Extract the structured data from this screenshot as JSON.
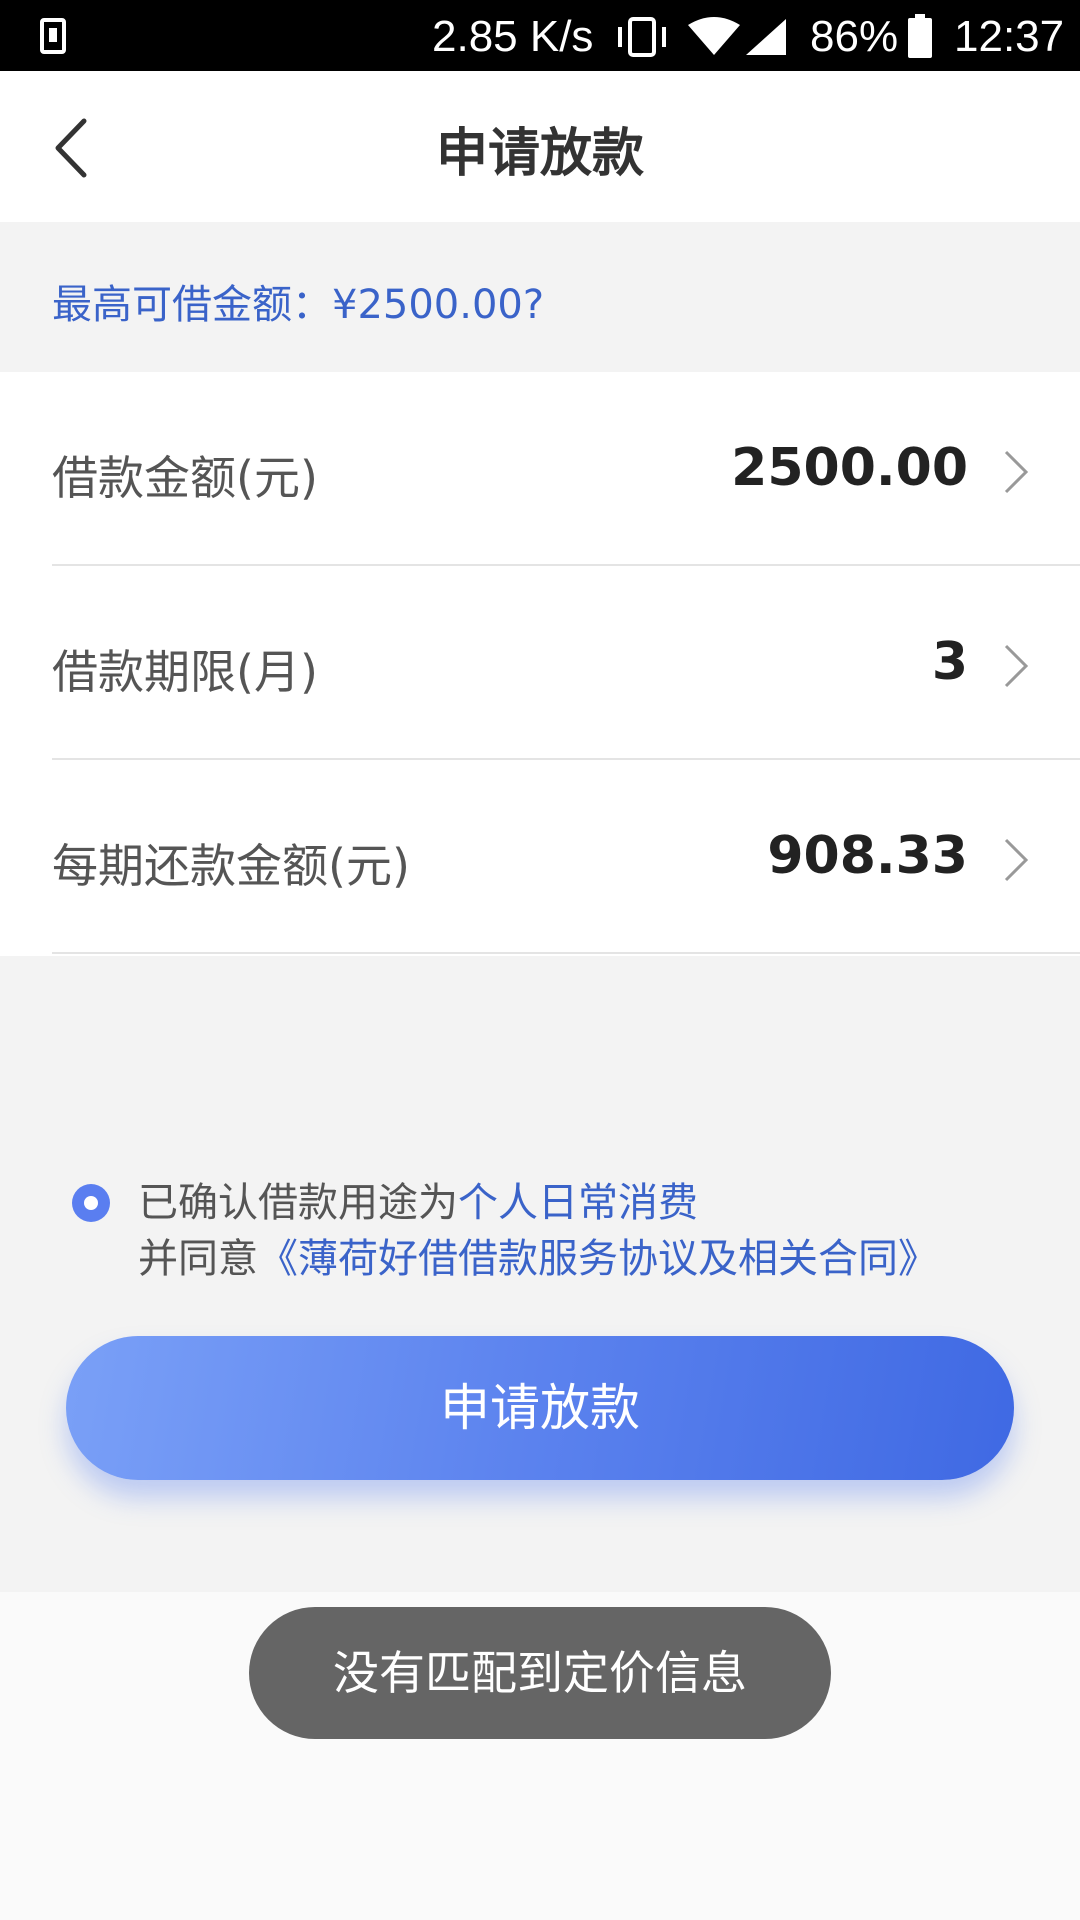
{
  "status_bar": {
    "net_speed": "2.85 K/s",
    "battery_percent": "86%",
    "time": "12:37",
    "icons": [
      "download-notification-icon",
      "vibrate-icon",
      "wifi-icon",
      "cell-signal-icon",
      "battery-icon"
    ]
  },
  "header": {
    "title": "申请放款",
    "back_icon": "back-chevron-icon"
  },
  "max_amount": {
    "text": "最高可借金额：¥2500.00?"
  },
  "form": {
    "rows": [
      {
        "label": "借款金额(元)",
        "value": "2500.00"
      },
      {
        "label": "借款期限(月)",
        "value": "3"
      },
      {
        "label": "每期还款金额(元)",
        "value": "908.33"
      }
    ]
  },
  "agreement": {
    "checked": true,
    "line1_prefix": "已确认借款用途为",
    "line1_purpose": "个人日常消费",
    "line2_prefix": "并同意",
    "line2_contract": "《薄荷好借借款服务协议及相关合同》"
  },
  "apply_button": {
    "label": "申请放款"
  },
  "toast": {
    "message": "没有匹配到定价信息"
  },
  "colors": {
    "accent_blue": "#3a63c9",
    "button_gradient_start": "#7aa0f7",
    "button_gradient_end": "#3f69e3",
    "toast_bg": "#656565"
  }
}
